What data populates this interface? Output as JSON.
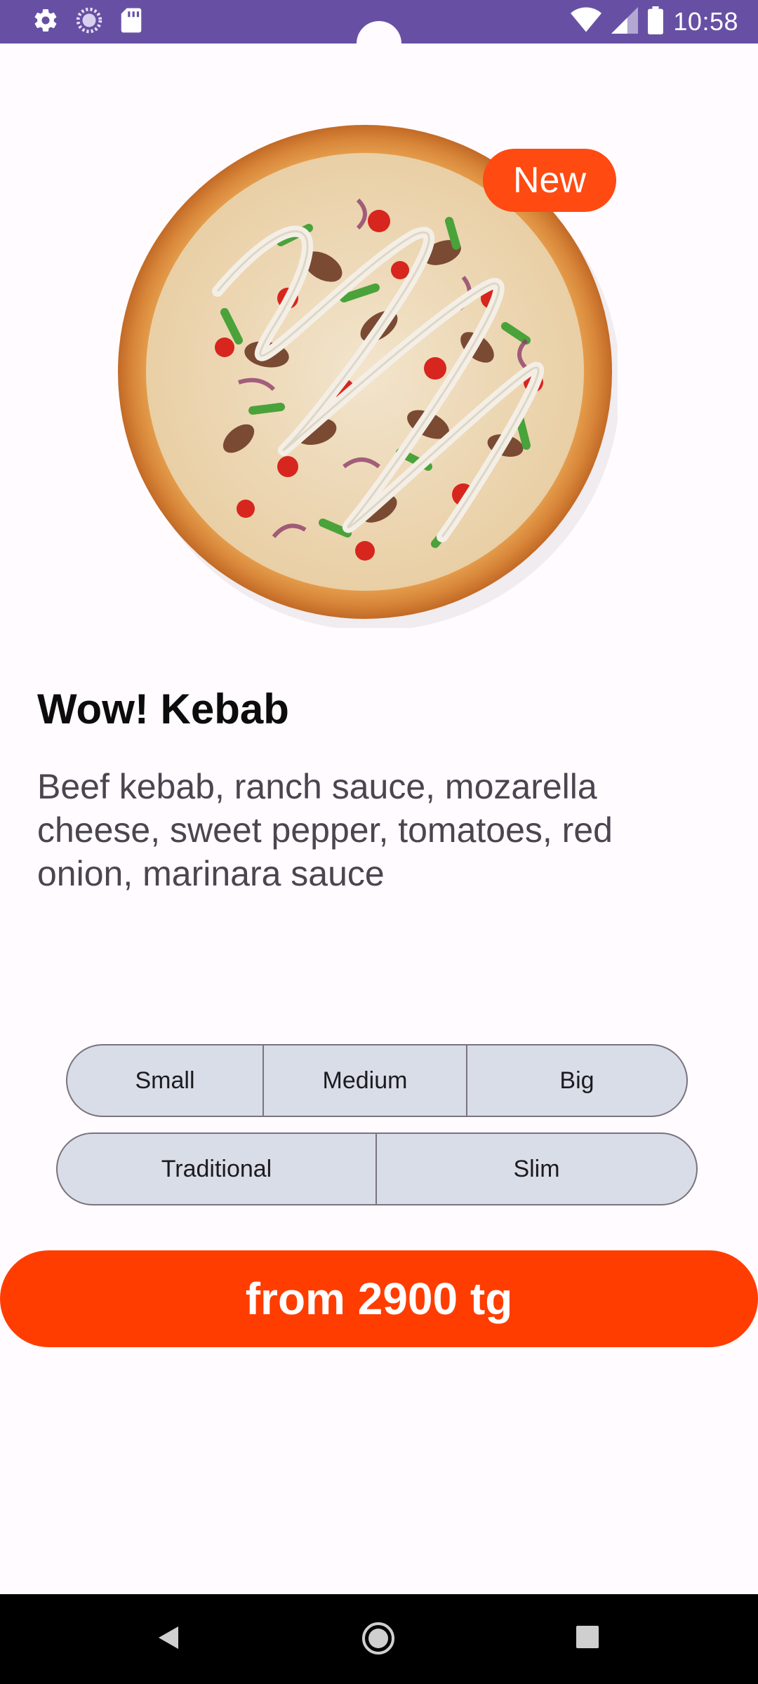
{
  "status_bar": {
    "time": "10:58",
    "left_icons": [
      "gear-icon",
      "loading-icon",
      "sd-card-icon"
    ],
    "right_icons": [
      "wifi-icon",
      "cell-signal-icon",
      "battery-icon"
    ]
  },
  "product": {
    "badge": "New",
    "title": "Wow! Kebab",
    "description": "Beef kebab, ranch sauce, mozarella cheese, sweet pepper, tomatoes, red onion, marinara sauce"
  },
  "size_options": [
    {
      "label": "Small"
    },
    {
      "label": "Medium"
    },
    {
      "label": "Big"
    }
  ],
  "crust_options": [
    {
      "label": "Traditional"
    },
    {
      "label": "Slim"
    }
  ],
  "price_button": {
    "label": "from 2900 tg"
  },
  "nav_bar": {
    "icons": [
      "back-icon",
      "home-icon",
      "recents-icon"
    ]
  },
  "colors": {
    "status_bar": "#6750a4",
    "accent": "#ff3d00",
    "badge": "#ff4a12",
    "segment_bg": "#d9dde8"
  }
}
